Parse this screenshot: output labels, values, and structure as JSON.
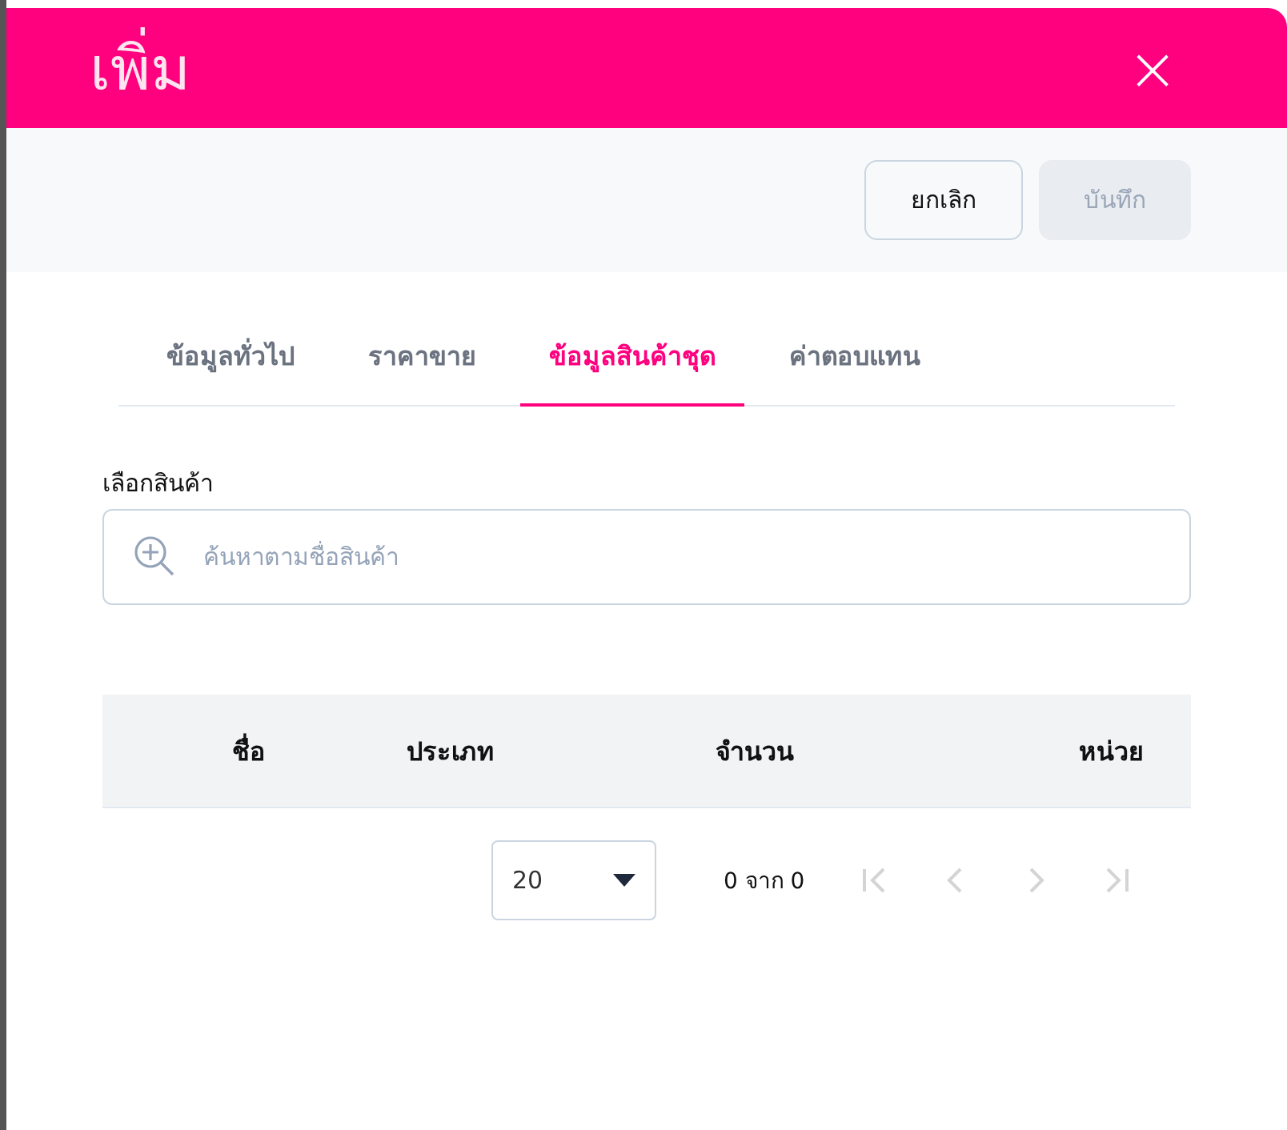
{
  "dialog": {
    "title": "เพิ่ม",
    "close": "×"
  },
  "toolbar": {
    "buttons": [
      {
        "kind": "secondary",
        "label": "ยกเลิก",
        "disabled": false
      },
      {
        "kind": "primary",
        "label": "บันทึก",
        "disabled": true
      }
    ]
  },
  "tabs": [
    {
      "label": "ข้อมูลทั่วไป",
      "selected": false
    },
    {
      "label": "ราคาขาย",
      "selected": false
    },
    {
      "label": "ข้อมูลสินค้าชุด",
      "selected": true
    },
    {
      "label": "ค่าตอบแทน",
      "selected": false
    }
  ],
  "product_field": {
    "label": "เลือกสินค้า",
    "placeholder": "ค้นหาตามชื่อสินค้า"
  },
  "table": {
    "columns": [
      "ชื่อ",
      "ประเภท",
      "จำนวน",
      "หน่วย"
    ]
  },
  "pagination": {
    "page_size": "20",
    "range": "0 จาก 0",
    "buttons": [
      {
        "kind": "first",
        "disabled": true
      },
      {
        "kind": "prev",
        "disabled": true
      },
      {
        "kind": "next",
        "disabled": true
      },
      {
        "kind": "last",
        "disabled": true
      }
    ]
  }
}
